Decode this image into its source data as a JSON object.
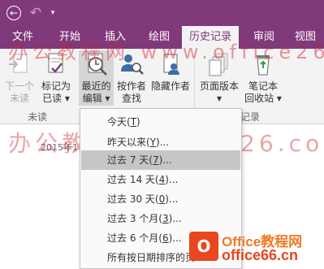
{
  "colors": {
    "accent": "#80397b",
    "ribbon_bg": "#f3f3f3",
    "menu_highlight": "#c6c6c6",
    "watermark": "#d2202a",
    "brand_orange": "#e8471f"
  },
  "quick_access": {
    "back_icon": "back-circle-icon",
    "back_glyph": "←",
    "undo_glyph": "↶",
    "more_glyph": "▾"
  },
  "tabs": [
    "文件",
    "开始",
    "插入",
    "绘图",
    "历史记录",
    "审阅",
    "视图"
  ],
  "ribbon": {
    "next_unread": {
      "line1": "下一个",
      "line2": "未读"
    },
    "mark_read": {
      "line1": "标记为",
      "line2": "已读 ▾"
    },
    "recent_edits": {
      "line1": "最近的",
      "line2": "编辑 ▾"
    },
    "find_by_author": {
      "line1": "按作者",
      "line2": "查找"
    },
    "hide_authors": {
      "line1": "隐藏作者",
      "line2": ""
    },
    "page_versions": {
      "line1": "页面版本",
      "line2": "▾"
    },
    "notebook_recycle_bin": {
      "line1": "笔记本",
      "line2": "回收站 ▾"
    },
    "group_unread": "未读",
    "group_record": "记录"
  },
  "watermark": {
    "line1": "办公教程网 www.office26.com",
    "line2": "办公教程网 office26.com"
  },
  "date_stamp": "2015年1",
  "menu": {
    "items": [
      {
        "label": "今天(",
        "key": "T",
        "suffix": ")"
      },
      {
        "label": "昨天以来(",
        "key": "Y",
        "suffix": ")..."
      },
      {
        "label": "过去 7 天(",
        "key": "7",
        "suffix": ")..."
      },
      {
        "label": "过去 14 天(",
        "key": "4",
        "suffix": ")..."
      },
      {
        "label": "过去 30 天(",
        "key": "0",
        "suffix": ")..."
      },
      {
        "label": "过去 3 个月(",
        "key": "3",
        "suffix": ")..."
      },
      {
        "label": "过去 6 个月(",
        "key": "6",
        "suffix": ")..."
      },
      {
        "label": "所有按日期排序的页",
        "key": "",
        "suffix": ""
      }
    ],
    "selected_index": 2
  },
  "brand": {
    "logo_letter": "O",
    "title": "Office教程网",
    "url": "office66.cn"
  }
}
